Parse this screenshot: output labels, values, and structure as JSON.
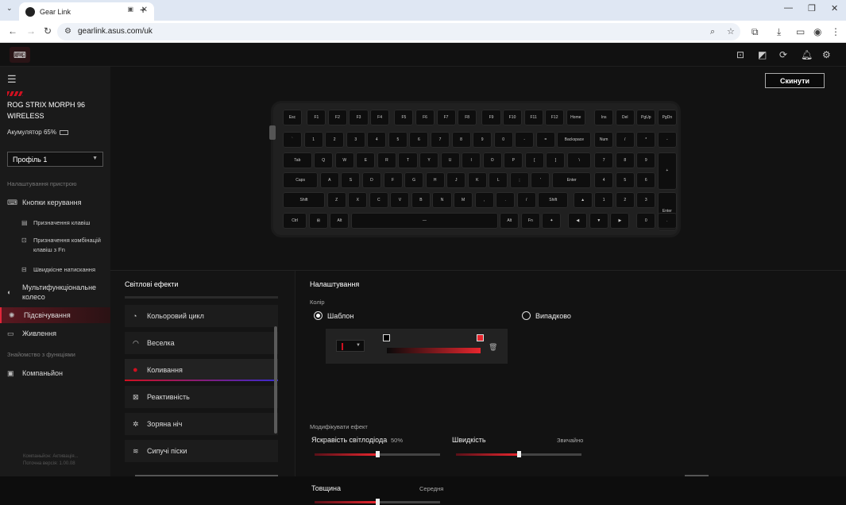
{
  "browser": {
    "tab_title": "Gear Link",
    "url": "gearlink.asus.com/uk",
    "window_controls": [
      "minimize",
      "maximize",
      "close"
    ]
  },
  "app": {
    "reset_button": "Скинути",
    "sidebar": {
      "device_name": "ROG STRIX MORPH 96 WIRELESS",
      "battery": "Акумулятор 65%",
      "profile": "Профіль 1",
      "section_device": "Налаштування пристрою",
      "nav_buttons": "Кнопки керування",
      "sub_assign": "Призначення клавіш",
      "sub_fn": "Призначення комбінацій клавіш з Fn",
      "sub_quick": "Швидкісне натискання",
      "nav_wheel": "Мультифункціональне колесо",
      "nav_lighting": "Підсвічування",
      "nav_power": "Живлення",
      "section_features": "Знайомство з функціями",
      "nav_companion": "Компаньйон",
      "version_line1": "Компаньйон: Активація...",
      "version_line2": "Поточна версія: 1.00.08"
    },
    "keyboard": {
      "rows": [
        [
          "Esc",
          "F1",
          "F2",
          "F3",
          "F4",
          "F5",
          "F6",
          "F7",
          "F8",
          "F9",
          "F10",
          "F11",
          "F12",
          "Home",
          "Ins",
          "Del",
          "PgUp",
          "PgDn"
        ],
        [
          "`",
          "1",
          "2",
          "3",
          "4",
          "5",
          "6",
          "7",
          "8",
          "9",
          "0",
          "-",
          "=",
          "Backspace",
          "Num",
          "/",
          "*",
          "-"
        ],
        [
          "Tab",
          "Q",
          "W",
          "E",
          "R",
          "T",
          "Y",
          "U",
          "I",
          "O",
          "P",
          "[",
          "]",
          "\\",
          "7",
          "8",
          "9",
          "+"
        ],
        [
          "Caps",
          "A",
          "S",
          "D",
          "F",
          "G",
          "H",
          "J",
          "K",
          "L",
          ";",
          "'",
          "Enter",
          "4",
          "5",
          "6"
        ],
        [
          "Shift",
          "Z",
          "X",
          "C",
          "V",
          "B",
          "N",
          "M",
          ",",
          ".",
          "/",
          "Shift",
          "▲",
          "1",
          "2",
          "3",
          "Enter"
        ],
        [
          "Ctrl",
          "⊞",
          "Alt",
          "—",
          "Alt",
          "Fn",
          "✦",
          "◀",
          "▼",
          "▶",
          "0",
          "."
        ]
      ]
    },
    "effects": {
      "title": "Світлові ефекти",
      "items": [
        "Кольоровий цикл",
        "Веселка",
        "Коливання",
        "Реактивність",
        "Зоряна ніч",
        "Сипучі піски"
      ],
      "selected": "Коливання"
    },
    "settings": {
      "title": "Налаштування",
      "color_label": "Колір",
      "option_template": "Шаблон",
      "option_random": "Випадково",
      "modify_label": "Модифікувати ефект",
      "brightness_label": "Яскравість світлодіода",
      "brightness_value": "50%",
      "brightness_pct": 50,
      "speed_label": "Швидкість",
      "speed_value": "Звичайно",
      "speed_pct": 50,
      "thickness_label": "Товщина",
      "thickness_value": "Середня",
      "thickness_pct": 50,
      "gradient_start_color": "#000000",
      "gradient_end_color": "#e8262e"
    }
  }
}
